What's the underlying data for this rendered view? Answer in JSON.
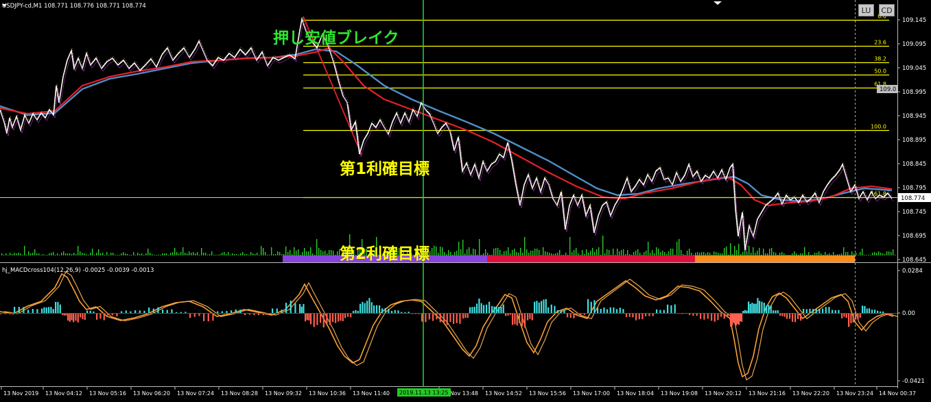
{
  "window": {
    "title": "USDJPY-cd,M1",
    "ohlc": "108.771 108.776 108.771 108.774"
  },
  "buttons": {
    "lu": "LU",
    "cd": "CD"
  },
  "main_axis": {
    "ticks": [
      "109.145",
      "109.095",
      "109.045",
      "108.995",
      "108.945",
      "108.895",
      "108.845",
      "108.795",
      "108.745",
      "108.695",
      "108.645"
    ],
    "current_price": "108.774",
    "ref_price": "109.0"
  },
  "fib_levels": [
    {
      "label": "0.0",
      "price": 109.145
    },
    {
      "label": "23.6",
      "price": 109.091
    },
    {
      "label": "38.2",
      "price": 109.057
    },
    {
      "label": "50.0",
      "price": 109.03
    },
    {
      "label": "61.8",
      "price": 109.003
    },
    {
      "label": "100.0",
      "price": 108.915
    },
    {
      "label": "161.8",
      "price": 108.775
    }
  ],
  "annotations": {
    "breakout": "押し安値ブレイク",
    "target1": "第1利確目標",
    "target2": "第2利確目標"
  },
  "indicator": {
    "title": "hj_MACDcross104(12,26,9) -0.0025 -0.0039 -0.0013",
    "ticks": [
      "0.0284",
      "0.00",
      "-0.0421"
    ]
  },
  "time_axis": {
    "labels": [
      "13 Nov 2019",
      "13 Nov 04:12",
      "13 Nov 05:16",
      "13 Nov 06:20",
      "13 Nov 07:24",
      "13 Nov 08:28",
      "13 Nov 09:32",
      "13 Nov 10:36",
      "13 Nov 11:40",
      "13 Nov 13:48",
      "13 Nov 14:52",
      "13 Nov 15:56",
      "13 Nov 17:00",
      "13 Nov 18:04",
      "13 Nov 19:08",
      "13 Nov 20:12",
      "13 Nov 21:16",
      "13 Nov 22:20",
      "13 Nov 23:24",
      "14 Nov 00:37"
    ],
    "cursor_label": "2019.11.13 13:25"
  },
  "colors": {
    "fib": "#ffff00",
    "ema_red": "#e8202a",
    "ema_blue": "#4f8fc8",
    "breakout_text": "#2ee62e",
    "target_text": "#ffff00",
    "volume": "#2bcc2b",
    "cursor": "#22dd22",
    "session_purple": "#8844dd",
    "session_red": "#e0103c",
    "session_orange": "#ff8c1a",
    "macd_orange": "#ffa030",
    "hist_cyan": "#40e0e0",
    "hist_red": "#ff6050"
  }
}
